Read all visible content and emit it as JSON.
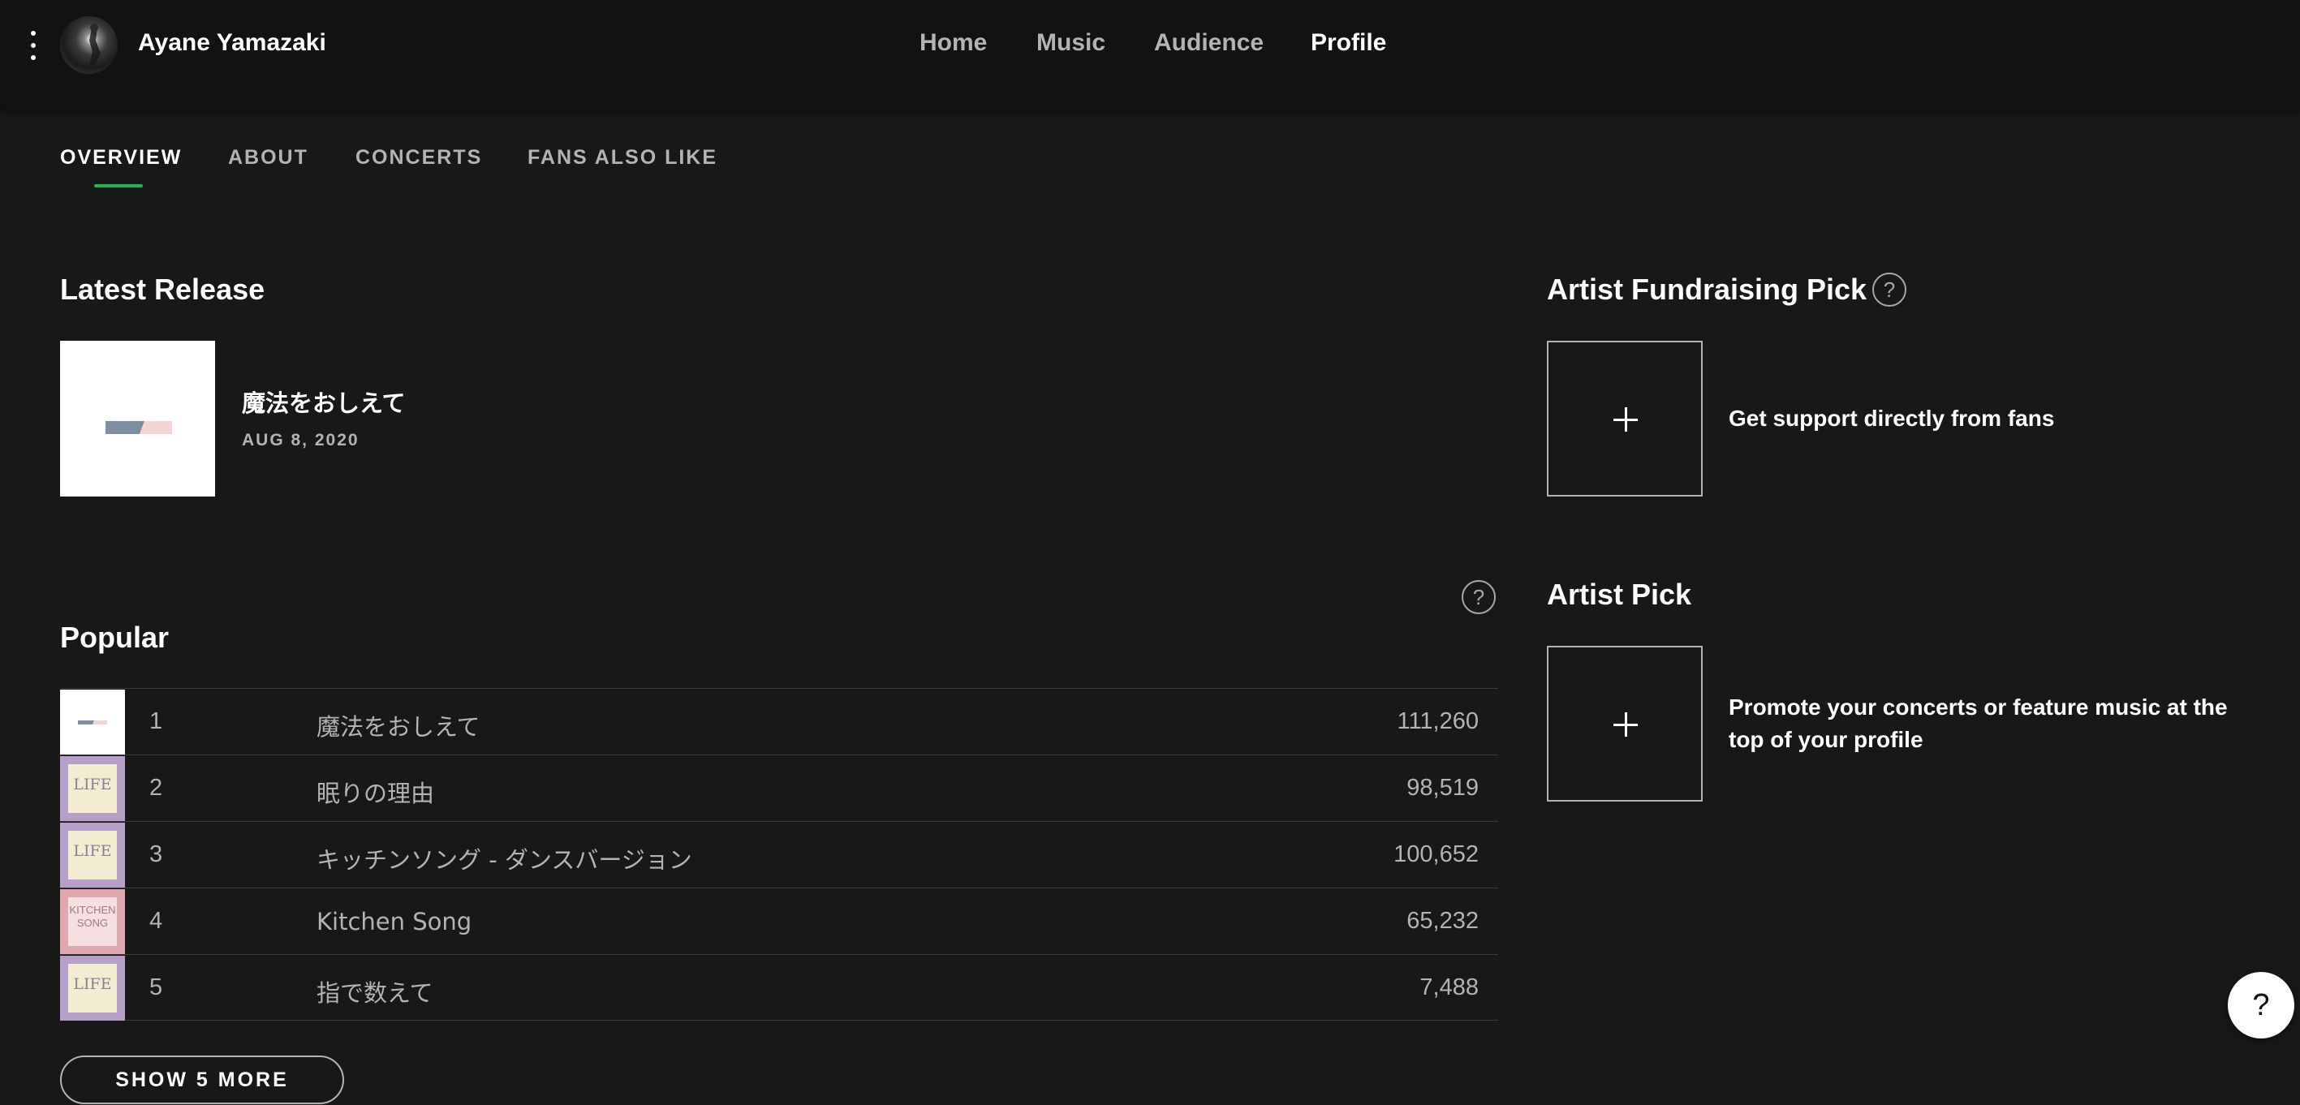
{
  "header": {
    "menu_icon": "vertical-dots-icon",
    "artist_name": "Ayane Yamazaki",
    "nav": [
      {
        "label": "Home",
        "active": false
      },
      {
        "label": "Music",
        "active": false
      },
      {
        "label": "Audience",
        "active": false
      },
      {
        "label": "Profile",
        "active": true
      }
    ]
  },
  "tabs": [
    {
      "label": "OVERVIEW",
      "active": true
    },
    {
      "label": "ABOUT",
      "active": false
    },
    {
      "label": "CONCERTS",
      "active": false
    },
    {
      "label": "FANS ALSO LIKE",
      "active": false
    }
  ],
  "latest_release": {
    "heading": "Latest Release",
    "title": "魔法をおしえて",
    "date": "AUG 8, 2020"
  },
  "popular": {
    "heading": "Popular",
    "help_symbol": "?",
    "tracks": [
      {
        "rank": "1",
        "title": "魔法をおしえて",
        "plays": "111,260",
        "art": "white-stripe"
      },
      {
        "rank": "2",
        "title": "眠りの理由",
        "plays": "98,519",
        "art": "life"
      },
      {
        "rank": "3",
        "title": "キッチンソング - ダンスバージョン",
        "plays": "100,652",
        "art": "life"
      },
      {
        "rank": "4",
        "title": "Kitchen Song",
        "plays": "65,232",
        "art": "kitchen-song"
      },
      {
        "rank": "5",
        "title": "指で数えて",
        "plays": "7,488",
        "art": "life"
      }
    ],
    "art_text": {
      "life": "LIFE",
      "kitchen_line1": "KITCHEN",
      "kitchen_line2": "SONG"
    },
    "show_more": "SHOW 5 MORE"
  },
  "fundraising": {
    "heading": "Artist Fundraising Pick",
    "help_symbol": "?",
    "text": "Get support directly from fans"
  },
  "artist_pick": {
    "heading": "Artist Pick",
    "text": "Promote your concerts or feature music at the top of your profile"
  },
  "help_button": "?",
  "colors": {
    "background": "#181818",
    "topbar": "#121212",
    "accent": "#1db954",
    "text_primary": "#ffffff",
    "text_secondary": "#b3b3b3"
  }
}
